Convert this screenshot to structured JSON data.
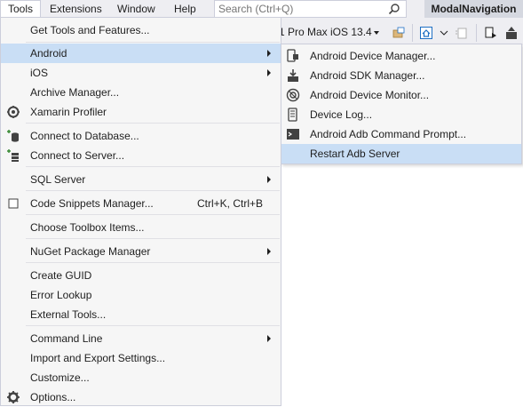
{
  "menubar": {
    "items": [
      "Tools",
      "Extensions",
      "Window",
      "Help"
    ],
    "search_placeholder": "Search (Ctrl+Q)",
    "project_name": "ModalNavigation"
  },
  "toolbar": {
    "device_label": "1 Pro Max iOS 13.4"
  },
  "tools_menu": {
    "items": [
      {
        "label": "Get Tools and Features..."
      },
      {
        "label": "Android"
      },
      {
        "label": "iOS"
      },
      {
        "label": "Archive Manager..."
      },
      {
        "label": "Xamarin Profiler"
      },
      {
        "label": "Connect to Database..."
      },
      {
        "label": "Connect to Server..."
      },
      {
        "label": "SQL Server"
      },
      {
        "label": "Code Snippets Manager...",
        "shortcut": "Ctrl+K, Ctrl+B"
      },
      {
        "label": "Choose Toolbox Items..."
      },
      {
        "label": "NuGet Package Manager"
      },
      {
        "label": "Create GUID"
      },
      {
        "label": "Error Lookup"
      },
      {
        "label": "External Tools..."
      },
      {
        "label": "Command Line"
      },
      {
        "label": "Import and Export Settings..."
      },
      {
        "label": "Customize..."
      },
      {
        "label": "Options..."
      }
    ]
  },
  "android_submenu": {
    "items": [
      {
        "label": "Android Device Manager..."
      },
      {
        "label": "Android SDK Manager..."
      },
      {
        "label": "Android Device Monitor..."
      },
      {
        "label": "Device Log..."
      },
      {
        "label": "Android Adb Command Prompt..."
      },
      {
        "label": "Restart Adb Server"
      }
    ]
  },
  "colors": {
    "menu_bg": "#f6f6f6",
    "highlight": "#c9def5",
    "chrome_bg": "#eeeef2",
    "border": "#cccedb"
  }
}
